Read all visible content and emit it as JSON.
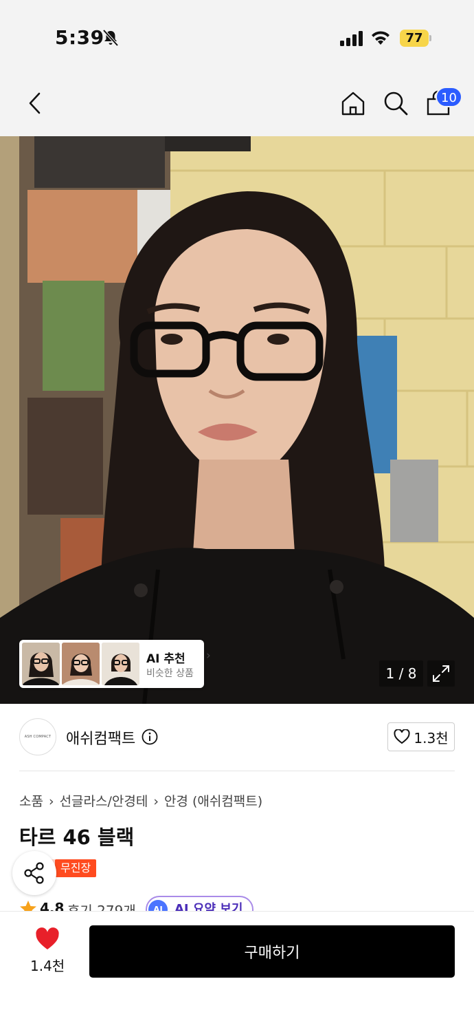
{
  "status_bar": {
    "time": "5:39",
    "battery": "77"
  },
  "nav": {
    "cart_count": "10"
  },
  "gallery": {
    "page_indicator": "1 / 8",
    "ai_card": {
      "title": "AI 추천",
      "subtitle": "비슷한 상품"
    }
  },
  "brand": {
    "name": "애쉬컴팩트",
    "logo_text": "ASH COMPACT",
    "likes": "1.3천"
  },
  "breadcrumb": [
    "소품",
    "선글라스/안경테",
    "안경 (애쉬컴팩트)"
  ],
  "product": {
    "title": "타르 46 블랙",
    "badge": "무진장",
    "rating": "4.8",
    "reviews": "후기 279개",
    "ai_summary": "AI 요약 보기",
    "ai_summary_icon": "AI"
  },
  "bottom_bar": {
    "favorite_count": "1.4천",
    "buy_label": "구매하기"
  },
  "colors": {
    "accent_blue": "#2b5cff",
    "badge_red": "#ff4b1f",
    "heart_red": "#e8202a",
    "buy_button": "#000000"
  }
}
